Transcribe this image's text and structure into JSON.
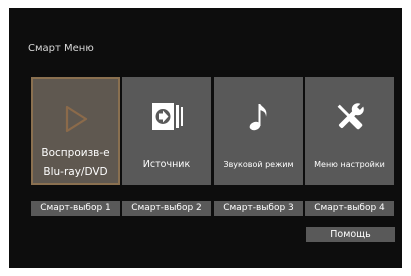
{
  "menu_title": "Смарт Меню",
  "tiles": [
    {
      "label": "Воспроизв-е Blu-ray/DVD",
      "icon": "play-icon",
      "selected": true
    },
    {
      "label": "Источник",
      "icon": "source-input-icon",
      "selected": false
    },
    {
      "label": "Звуковой режим",
      "icon": "music-note-icon",
      "selected": false
    },
    {
      "label": "Меню настройки",
      "icon": "tools-icon",
      "selected": false
    }
  ],
  "smart_select": [
    {
      "label": "Смарт-выбор 1"
    },
    {
      "label": "Смарт-выбор 2"
    },
    {
      "label": "Смарт-выбор 3"
    },
    {
      "label": "Смарт-выбор 4"
    }
  ],
  "help_label": "Помощь",
  "colors": {
    "background": "#0d0d0d",
    "tile": "#595959",
    "selected_border": "#8a7050",
    "play_icon": "#8b6a4a",
    "text": "#ffffff"
  }
}
